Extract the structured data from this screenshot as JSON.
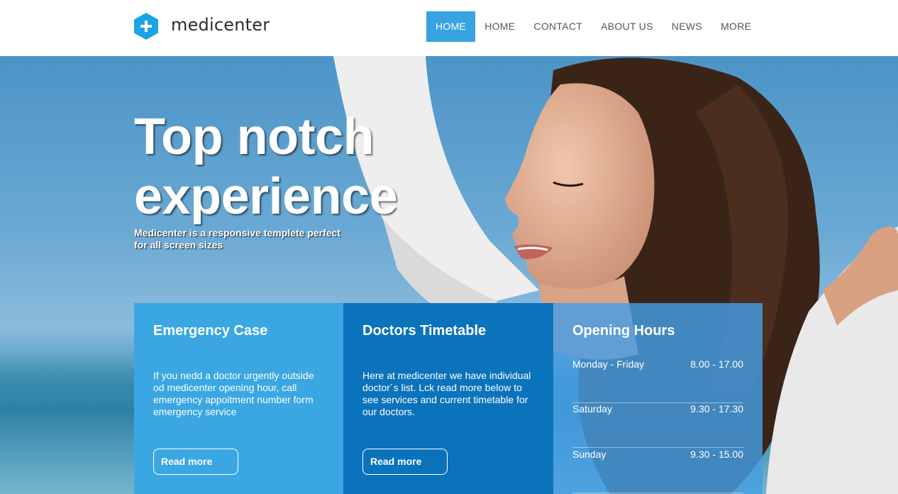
{
  "header": {
    "logo_text": "medicenter",
    "nav": [
      {
        "label": "HOME",
        "active": true
      },
      {
        "label": "HOME",
        "active": false
      },
      {
        "label": "CONTACT",
        "active": false
      },
      {
        "label": "ABOUT US",
        "active": false
      },
      {
        "label": "NEWS",
        "active": false
      },
      {
        "label": "MORE",
        "active": false
      }
    ]
  },
  "hero": {
    "title_line1": "Top notch",
    "title_line2": "experience",
    "subtitle": "Medicenter is a responsive templete perfect for all screen sizes"
  },
  "boxes": {
    "emergency": {
      "title": "Emergency Case",
      "text": "If you nedd a doctor urgently outside od medicenter opening hour, call emergency appoitment number form emergency service",
      "button": "Read more"
    },
    "timetable": {
      "title": "Doctors Timetable",
      "text": "Here at medicenter we have individual doctor´s list. Lck read more below to see services and current timetable for our doctors.",
      "button": "Read more"
    },
    "hours": {
      "title": "Opening Hours",
      "rows": [
        {
          "day": "Monday - Friday",
          "time": "8.00 - 17.00"
        },
        {
          "day": "Saturday",
          "time": "9.30 - 17.30"
        },
        {
          "day": "Sunday",
          "time": "9.30 - 15.00"
        }
      ]
    }
  },
  "colors": {
    "accent": "#37a3e0",
    "box_light": "#3aa7e2",
    "box_dark": "#0b73bb",
    "box_hours": "#469ee4"
  },
  "icons": {
    "logo": "medical-cross-hexagon-icon"
  }
}
